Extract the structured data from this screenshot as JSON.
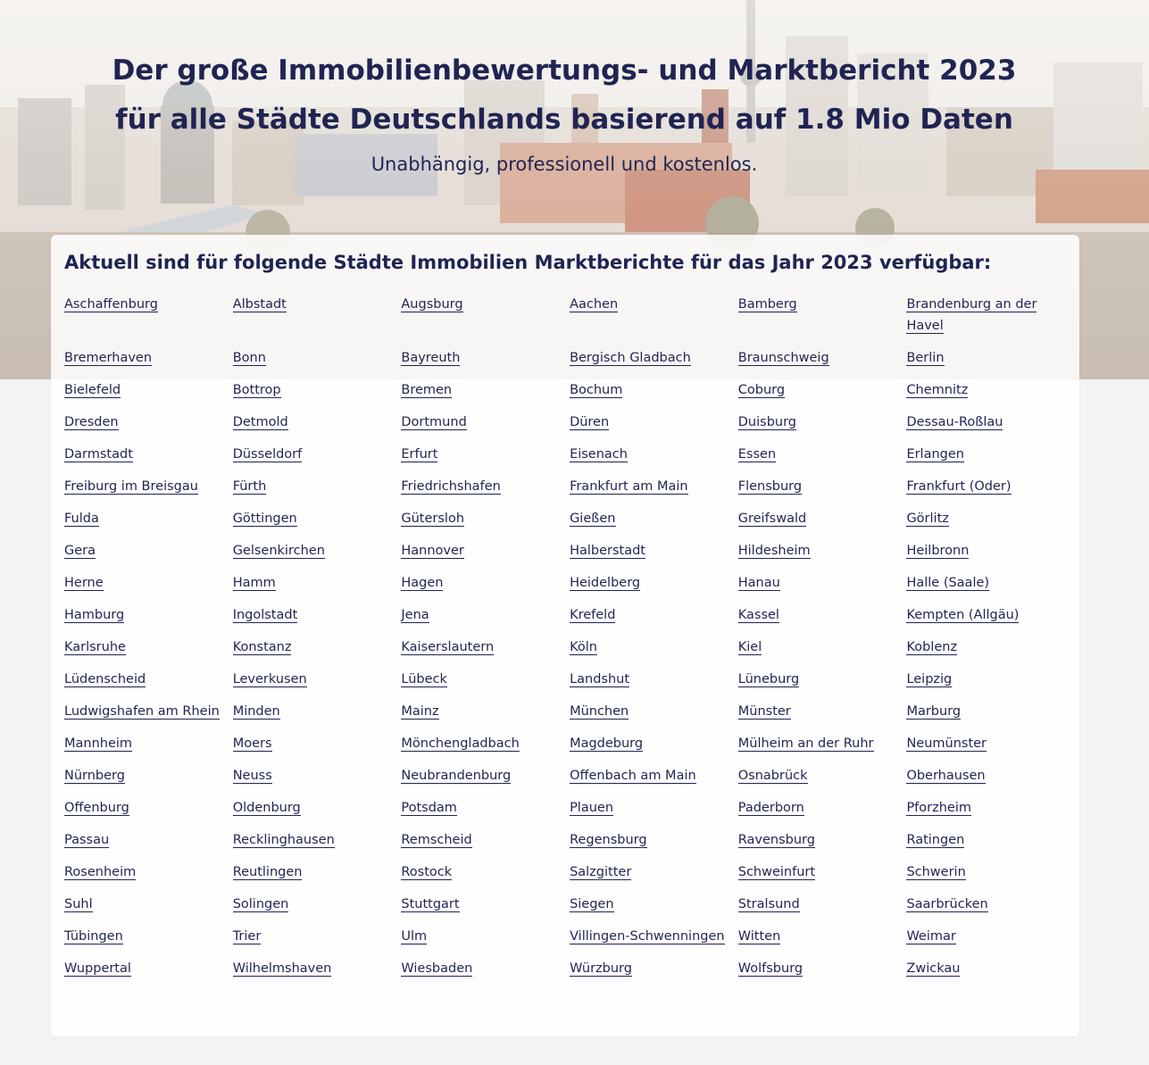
{
  "header": {
    "title_line1": "Der große Immobilienbewertungs- und Marktbericht 2023",
    "title_line2": "für alle Städte Deutschlands basierend auf 1.8 Mio Daten",
    "subtitle": "Unabhängig, professionell und kostenlos."
  },
  "main": {
    "heading": "Aktuell sind für folgende Städte Immobilien Marktberichte für das Jahr 2023 verfügbar:",
    "cities": [
      "Aschaffenburg",
      "Albstadt",
      "Augsburg",
      "Aachen",
      "Bamberg",
      "Brandenburg an der Havel",
      "Bremerhaven",
      "Bonn",
      "Bayreuth",
      "Bergisch Gladbach",
      "Braunschweig",
      "Berlin",
      "Bielefeld",
      "Bottrop",
      "Bremen",
      "Bochum",
      "Coburg",
      "Chemnitz",
      "Dresden",
      "Detmold",
      "Dortmund",
      "Düren",
      "Duisburg",
      "Dessau-Roßlau",
      "Darmstadt",
      "Düsseldorf",
      "Erfurt",
      "Eisenach",
      "Essen",
      "Erlangen",
      "Freiburg im Breisgau",
      "Fürth",
      "Friedrichshafen",
      "Frankfurt am Main",
      "Flensburg",
      "Frankfurt (Oder)",
      "Fulda",
      "Göttingen",
      "Gütersloh",
      "Gießen",
      "Greifswald",
      "Görlitz",
      "Gera",
      "Gelsenkirchen",
      "Hannover",
      "Halberstadt",
      "Hildesheim",
      "Heilbronn",
      "Herne",
      "Hamm",
      "Hagen",
      "Heidelberg",
      "Hanau",
      "Halle (Saale)",
      "Hamburg",
      "Ingolstadt",
      "Jena",
      "Krefeld",
      "Kassel",
      "Kempten (Allgäu)",
      "Karlsruhe",
      "Konstanz",
      "Kaiserslautern",
      "Köln",
      "Kiel",
      "Koblenz",
      "Lüdenscheid",
      "Leverkusen",
      "Lübeck",
      "Landshut",
      "Lüneburg",
      "Leipzig",
      "Ludwigshafen am Rhein",
      "Minden",
      "Mainz",
      "München",
      "Münster",
      "Marburg",
      "Mannheim",
      "Moers",
      "Mönchengladbach",
      "Magdeburg",
      "Mülheim an der Ruhr",
      "Neumünster",
      "Nürnberg",
      "Neuss",
      "Neubrandenburg",
      "Offenbach am Main",
      "Osnabrück",
      "Oberhausen",
      "Offenburg",
      "Oldenburg",
      "Potsdam",
      "Plauen",
      "Paderborn",
      "Pforzheim",
      "Passau",
      "Recklinghausen",
      "Remscheid",
      "Regensburg",
      "Ravensburg",
      "Ratingen",
      "Rosenheim",
      "Reutlingen",
      "Rostock",
      "Salzgitter",
      "Schweinfurt",
      "Schwerin",
      "Suhl",
      "Solingen",
      "Stuttgart",
      "Siegen",
      "Stralsund",
      "Saarbrücken",
      "Tübingen",
      "Trier",
      "Ulm",
      "Villingen-Schwenningen",
      "Witten",
      "Weimar",
      "Wuppertal",
      "Wilhelmshaven",
      "Wiesbaden",
      "Würzburg",
      "Wolfsburg",
      "Zwickau"
    ]
  },
  "colors": {
    "primary_text": "#1f2453",
    "card_background": "#ffffff",
    "page_background": "#f4f3f3"
  }
}
